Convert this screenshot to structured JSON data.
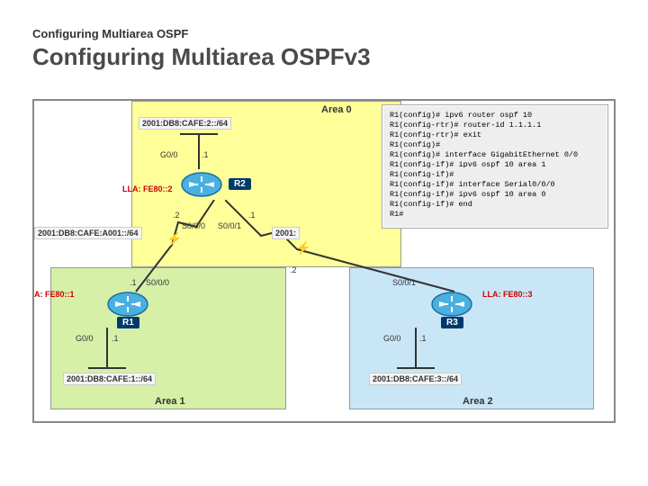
{
  "header": {
    "small_title": "Configuring Multiarea OSPF",
    "large_title": "Configuring Multiarea OSPFv3"
  },
  "areas": {
    "area0": {
      "label": "Area 0"
    },
    "area1": {
      "label": "Area 1"
    },
    "area2": {
      "label": "Area 2"
    }
  },
  "addresses": {
    "net0": "2001:DB8:CAFE:2::/64",
    "netA001": "2001:DB8:CAFE:A001::/64",
    "netA001r": "2001:",
    "net1": "2001:DB8:CAFE:1::/64",
    "net3": "2001:DB8:CAFE:3::/64",
    "lla1": "A: FE80::1",
    "lla2": "LLA: FE80::2",
    "lla3": "LLA: FE80::3"
  },
  "interfaces": {
    "r2_g00": "G0/0",
    "r2_g00_id": ".1",
    "r2_s000": "S0/0/0",
    "r2_s000_id": ".2",
    "r2_s001": "S0/0/1",
    "r2_s001_id": ".1",
    "r1_g00": "G0/0",
    "r1_g00_id": ".1",
    "r1_s000": "S0/0/0",
    "r1_s000_id": ".1",
    "r3_g00": "G0/0",
    "r3_g00_id": ".1",
    "r3_s001": "S0/0/1",
    "r3_s001_id": ".2"
  },
  "routers": {
    "r1": "R1",
    "r2": "R2",
    "r3": "R3"
  },
  "terminal": {
    "l1": "R1(config)# ipv6 router ospf 10",
    "l2": "R1(config-rtr)# router-id 1.1.1.1",
    "l3": "R1(config-rtr)# exit",
    "l4": "R1(config)#",
    "l5": "R1(config)# interface GigabitEthernet 0/0",
    "l6": "R1(config-if)# ipv6 ospf 10 area 1",
    "l7": "R1(config-if)#",
    "l8": "R1(config-if)# interface Serial0/0/0",
    "l9": "R1(config-if)# ipv6 ospf 10 area 0",
    "l10": "R1(config-if)# end",
    "l11": "R1#"
  }
}
